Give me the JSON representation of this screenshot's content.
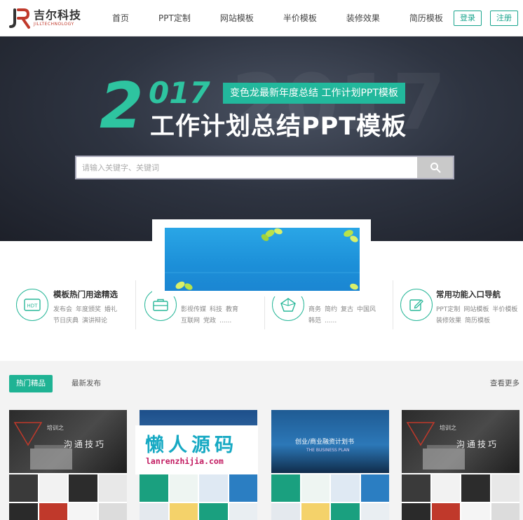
{
  "brand": {
    "name_cn": "吉尔科技",
    "name_en": "JILLTECHNOLOGY"
  },
  "nav": {
    "items": [
      "首页",
      "PPT定制",
      "网站模板",
      "半价模板",
      "装修效果",
      "简历模板"
    ],
    "login": "登录",
    "register": "注册"
  },
  "hero": {
    "year_first": "2",
    "year_rest": "017",
    "tag": "变色龙最新年度总结  工作计划PPT模板",
    "title": "工作计划总结PPT模板",
    "search_placeholder": "请输入关键字、关键词"
  },
  "features": [
    {
      "title": "模板热门用途精选",
      "links": [
        "发布会",
        "年度颁奖",
        "婚礼",
        "节日庆典",
        "演讲辩论"
      ]
    },
    {
      "title": "",
      "links": [
        "影视传媒",
        "科技",
        "教育",
        "互联网",
        "党政",
        "......"
      ]
    },
    {
      "title": "",
      "links": [
        "商务",
        "简约",
        "复古",
        "中国风",
        "韩范",
        "......"
      ]
    },
    {
      "title": "常用功能入口导航",
      "links": [
        "PPT定制",
        "网站模板",
        "半价模板",
        "装修效果",
        "简历模板"
      ]
    }
  ],
  "section": {
    "tab_active": "热门精品",
    "tab": "最新发布",
    "more": "查看更多"
  },
  "cards": [
    {
      "title": "沟通技巧",
      "subtitle": "培训之"
    },
    {
      "title": "",
      "subtitle": ""
    },
    {
      "title": "创业/商业融资计划书",
      "subtitle": "THE BUSINESS PLAN"
    },
    {
      "title": "沟通技巧",
      "subtitle": "培训之"
    }
  ],
  "watermark": {
    "cn": "懒人源码",
    "url": "lanrenzhijia.com"
  },
  "colors": {
    "accent": "#1fb394",
    "hero_bg": "#2e3441",
    "watermark_cn": "#16a9c3",
    "watermark_url": "#c21b61"
  }
}
